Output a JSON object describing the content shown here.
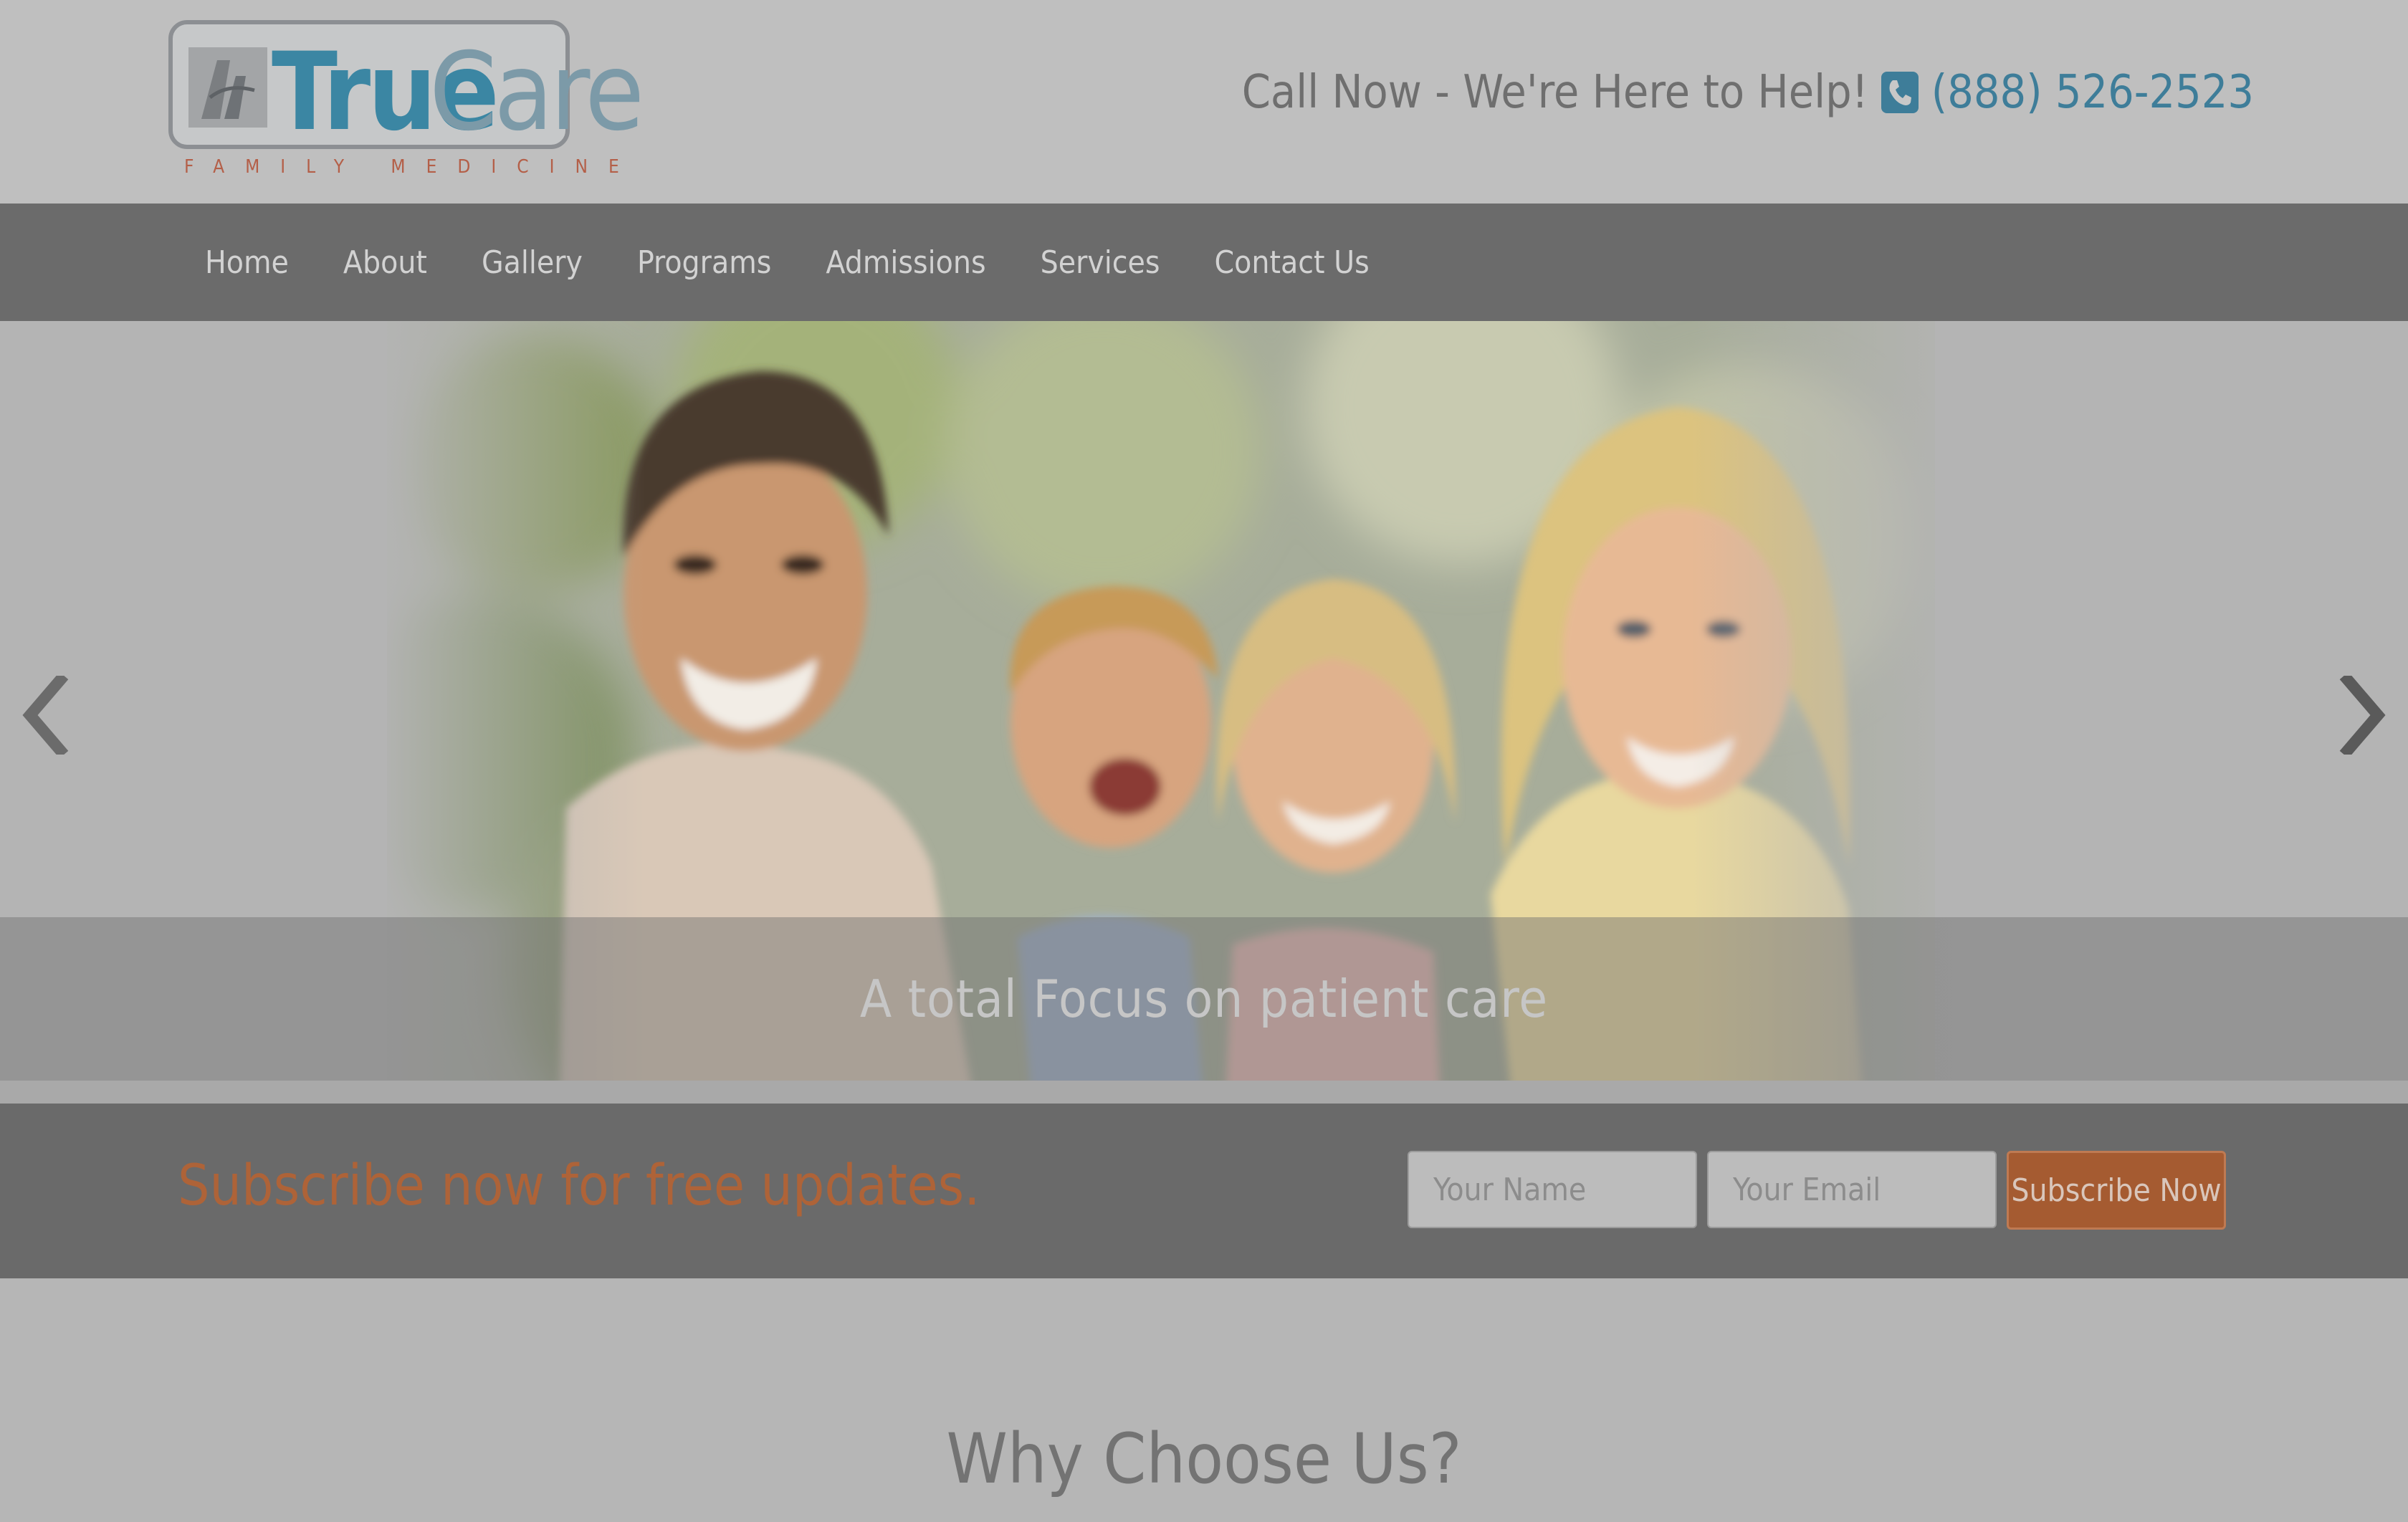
{
  "header": {
    "logo": {
      "word_true": "True",
      "word_care": "Care",
      "tagline": "FAMILY MEDICINE"
    },
    "call_text": "Call Now - We're Here to Help!",
    "phone_icon": "phone-icon",
    "phone_number": "(888) 526-2523"
  },
  "nav": {
    "items": [
      {
        "label": "Home"
      },
      {
        "label": "About"
      },
      {
        "label": "Gallery"
      },
      {
        "label": "Programs"
      },
      {
        "label": "Admissions"
      },
      {
        "label": "Services"
      },
      {
        "label": "Contact Us"
      }
    ]
  },
  "hero": {
    "caption": "A total Focus on patient care",
    "prev_icon": "chevron-left-icon",
    "next_icon": "chevron-right-icon"
  },
  "subscribe": {
    "headline": "Subscribe now for free updates.",
    "name_placeholder": "Your Name",
    "email_placeholder": "Your Email",
    "button_label": "Subscribe Now"
  },
  "why": {
    "title": "Why Choose Us?"
  },
  "colors": {
    "accent_blue": "#3e7d99",
    "accent_orange": "#ae6338",
    "nav_bg": "#6b6b6b"
  }
}
